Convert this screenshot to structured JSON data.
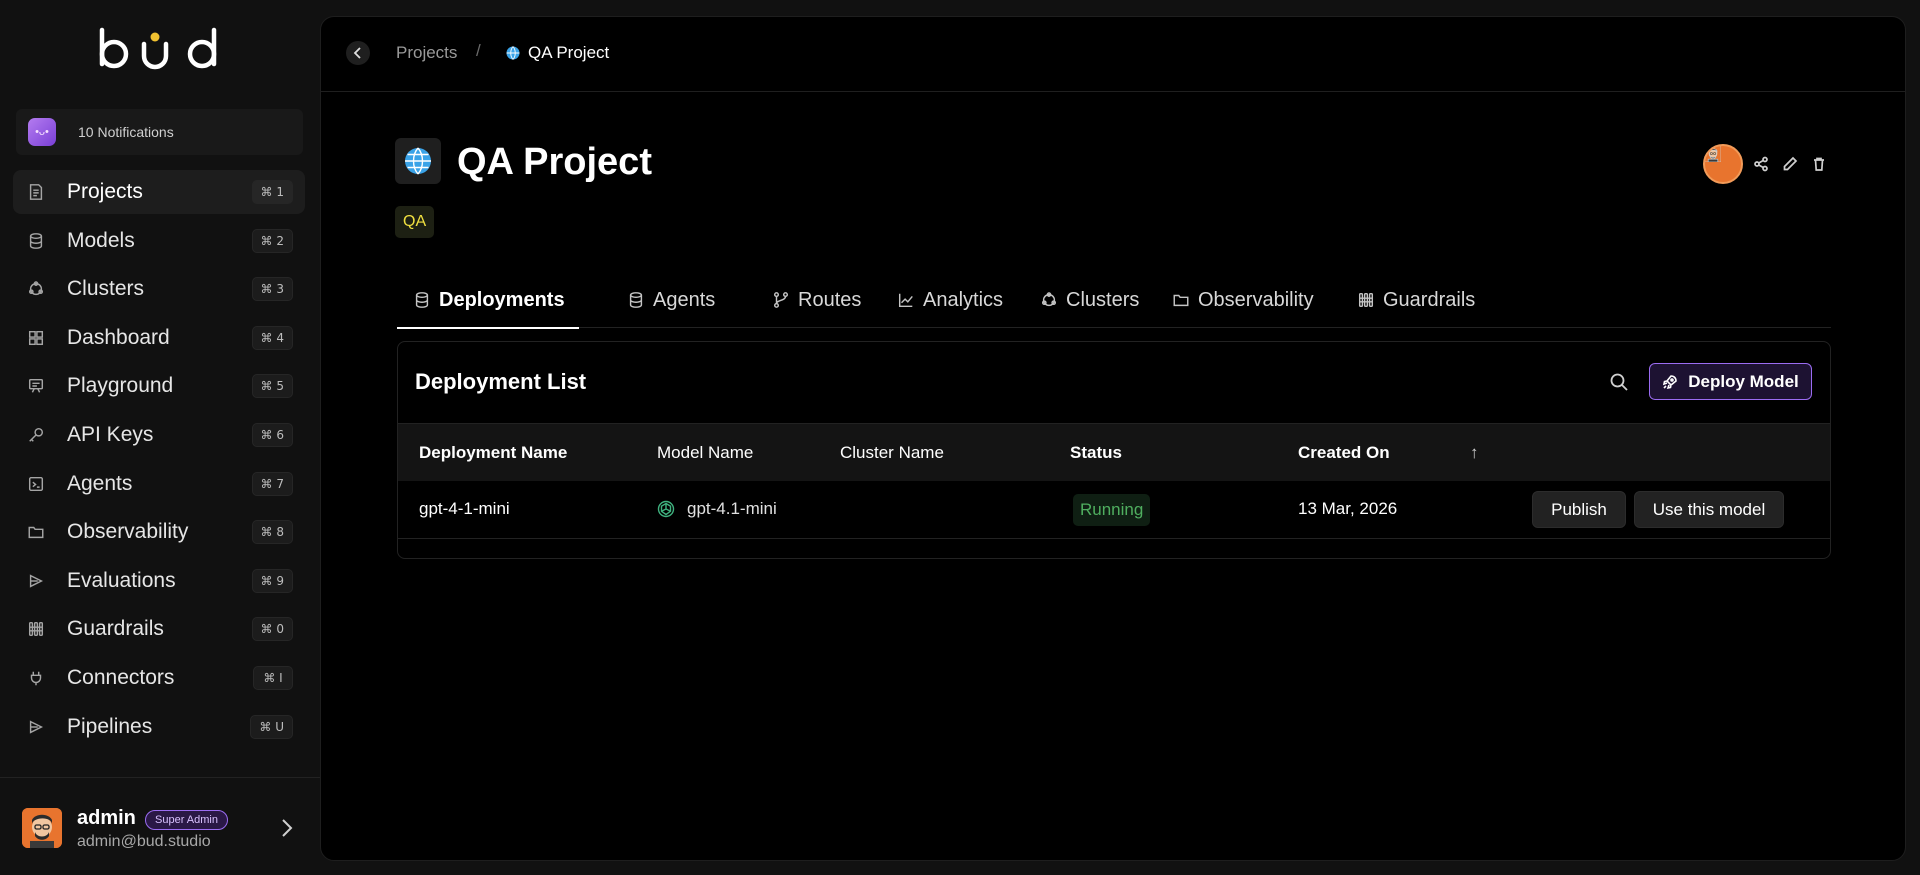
{
  "brand": {
    "logo_text": "bud"
  },
  "notifications": {
    "label": "10 Notifications"
  },
  "sidebar": {
    "items": [
      {
        "label": "Projects",
        "shortcut": "⌘ 1",
        "icon": "document-icon",
        "active": true
      },
      {
        "label": "Models",
        "shortcut": "⌘ 2",
        "icon": "database-icon"
      },
      {
        "label": "Clusters",
        "shortcut": "⌘ 3",
        "icon": "cluster-icon"
      },
      {
        "label": "Dashboard",
        "shortcut": "⌘ 4",
        "icon": "grid-icon"
      },
      {
        "label": "Playground",
        "shortcut": "⌘ 5",
        "icon": "playground-icon"
      },
      {
        "label": "API Keys",
        "shortcut": "⌘ 6",
        "icon": "key-icon"
      },
      {
        "label": "Agents",
        "shortcut": "⌘ 7",
        "icon": "terminal-icon"
      },
      {
        "label": "Observability",
        "shortcut": "⌘ 8",
        "icon": "folder-icon"
      },
      {
        "label": "Evaluations",
        "shortcut": "⌘ 9",
        "icon": "evaluation-icon"
      },
      {
        "label": "Guardrails",
        "shortcut": "⌘ 0",
        "icon": "guardrail-icon"
      },
      {
        "label": "Connectors",
        "shortcut": "⌘ I",
        "icon": "plug-icon"
      },
      {
        "label": "Pipelines",
        "shortcut": "⌘ U",
        "icon": "pipeline-icon"
      }
    ]
  },
  "user": {
    "name": "admin",
    "role": "Super Admin",
    "email": "admin@bud.studio"
  },
  "breadcrumb": {
    "parent": "Projects",
    "separator": "/",
    "current": "QA Project"
  },
  "project": {
    "title": "QA Project",
    "tag": "QA"
  },
  "tabs": [
    {
      "label": "Deployments",
      "icon": "database-icon",
      "active": true
    },
    {
      "label": "Agents",
      "icon": "database-icon"
    },
    {
      "label": "Routes",
      "icon": "branch-icon"
    },
    {
      "label": "Analytics",
      "icon": "chart-icon"
    },
    {
      "label": "Clusters",
      "icon": "cluster-icon"
    },
    {
      "label": "Observability",
      "icon": "folder-icon"
    },
    {
      "label": "Guardrails",
      "icon": "guardrail-icon"
    }
  ],
  "deployments": {
    "title": "Deployment List",
    "deploy_button": "Deploy Model",
    "columns": [
      "Deployment Name",
      "Model Name",
      "Cluster Name",
      "Status",
      "Created On"
    ],
    "sort_indicator": "↑",
    "rows": [
      {
        "deployment_name": "gpt-4-1-mini",
        "model_name": "gpt-4.1-mini",
        "cluster_name": "",
        "status": "Running",
        "created_on": "13 Mar, 2026",
        "publish_label": "Publish",
        "use_label": "Use this model"
      }
    ]
  },
  "colors": {
    "accent": "#9b6cf2",
    "status_running": "#4fae5f",
    "tag_text": "#f0e040"
  }
}
